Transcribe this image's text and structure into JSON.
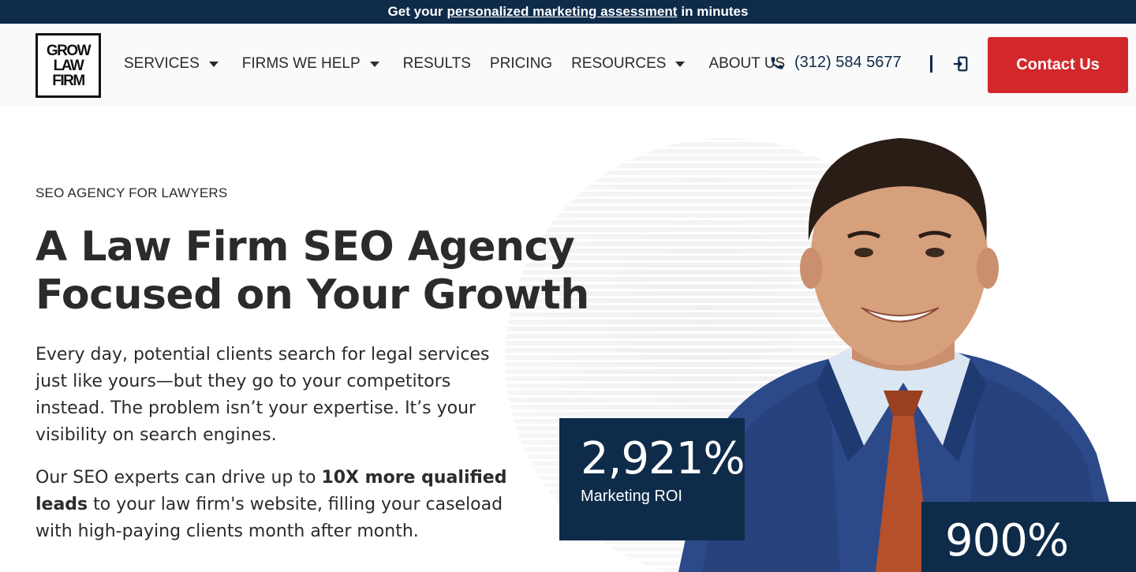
{
  "banner": {
    "prefix": "Get your",
    "link": "personalized marketing assessment",
    "suffix": "in minutes"
  },
  "logo": {
    "lines": [
      "GROW",
      "LAW",
      "FIRM"
    ]
  },
  "nav": {
    "items": [
      {
        "label": "SERVICES",
        "has_dropdown": true
      },
      {
        "label": "FIRMS WE HELP",
        "has_dropdown": true
      },
      {
        "label": "RESULTS",
        "has_dropdown": false
      },
      {
        "label": "PRICING",
        "has_dropdown": false
      },
      {
        "label": "RESOURCES",
        "has_dropdown": true
      },
      {
        "label": "ABOUT US",
        "has_dropdown": false
      }
    ]
  },
  "header": {
    "phone": "(312) 584 5677",
    "contact_label": "Contact Us",
    "icons": [
      "phone-icon",
      "login-icon",
      "chevron-down-icon"
    ]
  },
  "hero": {
    "eyebrow": "SEO AGENCY FOR LAWYERS",
    "headline_line1": "A Law Firm SEO Agency",
    "headline_line2": "Focused on Your Growth",
    "paragraph1": "Every day, potential clients search for legal services just like yours—but they go to your competitors instead. The problem isn’t your expertise. It’s your visibility on search engines.",
    "paragraph2_before": "Our SEO experts can drive up to ",
    "paragraph2_bold": "10X more qualified leads",
    "paragraph2_after": " to your law firm's website, filling your caseload with high-paying clients month after month."
  },
  "stats": [
    {
      "value": "2,921%",
      "label": "Marketing ROI"
    },
    {
      "value": "900%",
      "label": ""
    }
  ],
  "colors": {
    "navy": "#0e2b4a",
    "red": "#d3282b",
    "text": "#2b2b2b"
  }
}
